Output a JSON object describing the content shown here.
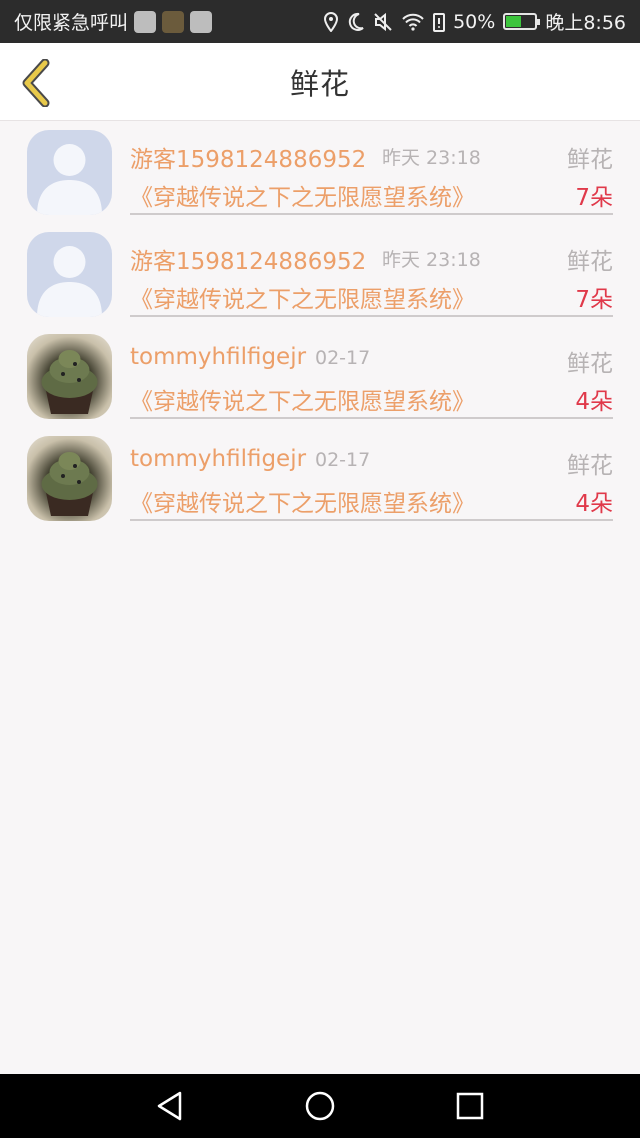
{
  "status_bar": {
    "carrier_text": "仅限紧急呼叫",
    "battery_text": "50%",
    "time": "晚上8:56",
    "battery_level": 0.5
  },
  "header": {
    "title": "鲜花"
  },
  "rows": [
    {
      "username": "游客1598124886952",
      "time": "昨天 23:18",
      "gift_type": "鲜花",
      "book_title": "《穿越传说之下之无限愿望系统》",
      "count": "7朵",
      "avatar": "default-user"
    },
    {
      "username": "游客1598124886952",
      "time": "昨天 23:18",
      "gift_type": "鲜花",
      "book_title": "《穿越传说之下之无限愿望系统》",
      "count": "7朵",
      "avatar": "default-user"
    },
    {
      "username": "tommyhfilfigejr",
      "time": "02-17",
      "gift_type": "鲜花",
      "book_title": "《穿越传说之下之无限愿望系统》",
      "count": "4朵",
      "avatar": "cupcake-photo"
    },
    {
      "username": "tommyhfilfigejr",
      "time": "02-17",
      "gift_type": "鲜花",
      "book_title": "《穿越传说之下之无限愿望系统》",
      "count": "4朵",
      "avatar": "cupcake-photo"
    }
  ],
  "colors": {
    "accent_orange": "#ec9f69",
    "count_red": "#e0394a",
    "back_arrow": "#e8c94a"
  }
}
